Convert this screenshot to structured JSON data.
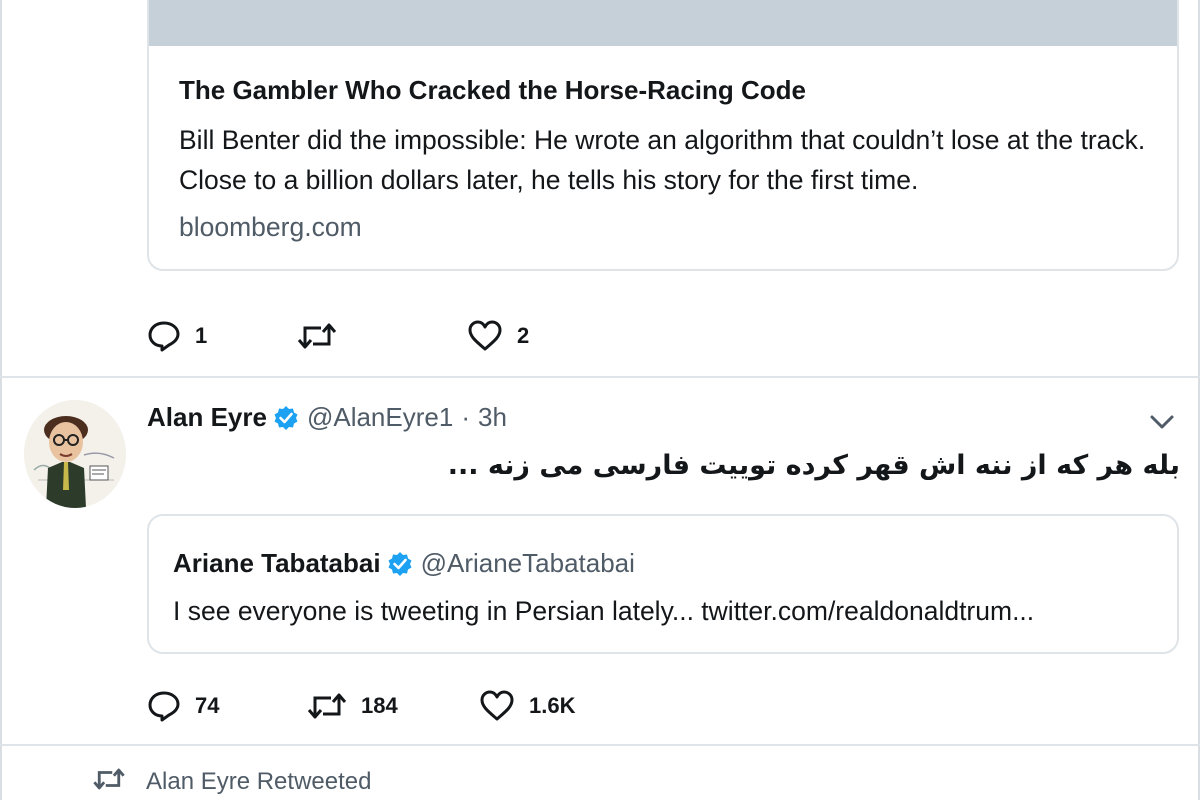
{
  "tweet1": {
    "card": {
      "title": "The Gambler Who Cracked the Horse-Racing Code",
      "description": "Bill Benter did the impossible: He wrote an algorithm that couldn’t lose at the track. Close to a billion dollars later, he tells his story for the first time.",
      "domain": "bloomberg.com"
    },
    "actions": {
      "replies": "1",
      "retweets": "",
      "likes": "2"
    }
  },
  "tweet2": {
    "author": {
      "name": "Alan Eyre",
      "verified": true,
      "handle": "@AlanEyre1",
      "separator": "·",
      "time": "3h"
    },
    "text": "بله هر که از ننه اش قهر کرده توییت فارسی می زنه ...",
    "quote": {
      "name": "Ariane Tabatabai",
      "verified": true,
      "handle": "@ArianeTabatabai",
      "text": "I see everyone is tweeting in Persian lately... twitter.com/realdonaldtrum..."
    },
    "actions": {
      "replies": "74",
      "retweets": "184",
      "likes": "1.6K"
    }
  },
  "retweet_banner": {
    "label": "Alan Eyre Retweeted"
  },
  "icons": {
    "reply": "reply-icon",
    "retweet": "retweet-icon",
    "like": "heart-icon",
    "verified": "verified-badge-icon",
    "more": "chevron-down-icon"
  },
  "colors": {
    "verified_blue": "#1da1f2",
    "secondary_text": "#4f5b66",
    "border": "#dfe4e8"
  }
}
